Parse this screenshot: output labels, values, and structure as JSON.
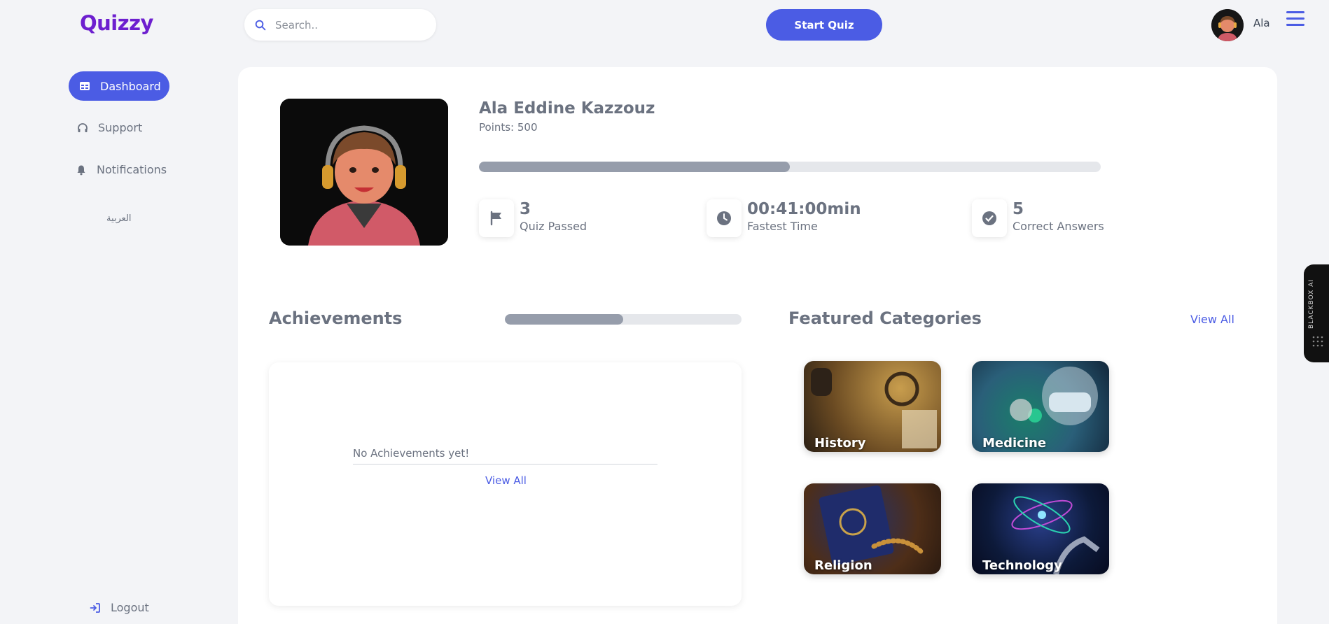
{
  "header": {
    "logo": "Quizzy",
    "search_placeholder": "Search..",
    "start_quiz_label": "Start Quiz",
    "user_name": "Ala"
  },
  "sidebar": {
    "items": [
      {
        "label": "Dashboard",
        "icon": "dashboard-icon",
        "active": true
      },
      {
        "label": "Support",
        "icon": "headphones-icon"
      },
      {
        "label": "Notifications",
        "icon": "bell-icon"
      }
    ],
    "language_label": "العربية",
    "logout_label": "Logout"
  },
  "profile": {
    "name": "Ala Eddine Kazzouz",
    "points": "Points: 500",
    "progress": 0.5
  },
  "stats": [
    {
      "value": "3",
      "label": "Quiz Passed",
      "icon": "flag-icon"
    },
    {
      "value": "00:41:00min",
      "label": "Fastest Time",
      "icon": "clock-icon"
    },
    {
      "value": "5",
      "label": "Correct Answers",
      "icon": "check-circle-icon"
    }
  ],
  "achievements": {
    "title": "Achievements",
    "progress": 0.5,
    "empty_text": "No Achievements yet!",
    "view_all": "View All"
  },
  "featured": {
    "title": "Featured Categories",
    "view_all": "View All",
    "categories": [
      "History",
      "Medicine",
      "Religion",
      "Technology"
    ]
  },
  "side_widget": {
    "label": "BLACKBOX AI"
  },
  "colors": {
    "accent": "#4b5ce4",
    "logo": "#6d1fcf",
    "progress_fill": "#969dab"
  }
}
